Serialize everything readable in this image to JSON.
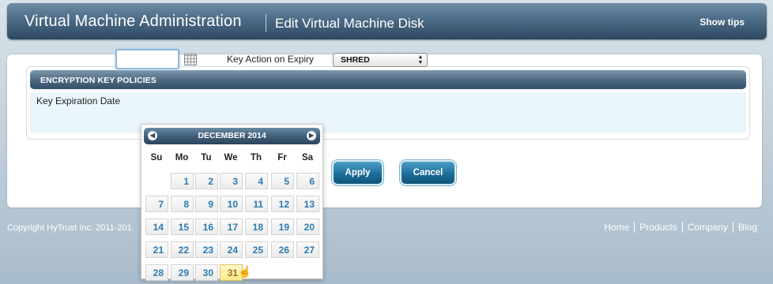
{
  "header": {
    "app_title": "Virtual Machine Administration",
    "page_title": "Edit Virtual Machine Disk",
    "show_tips": "Show tips"
  },
  "section": {
    "title": "ENCRYPTION KEY POLICIES",
    "expiration_label": "Key Expiration Date",
    "expiration_value": "",
    "action_label": "Key Action on Expiry",
    "action_value": "SHRED"
  },
  "buttons": {
    "apply": "Apply",
    "cancel": "Cancel"
  },
  "footer": {
    "copyright": "Copyright HyTrust Inc. 2011-201",
    "links": [
      "Home",
      "Products",
      "Company",
      "Blog"
    ]
  },
  "datepicker": {
    "month": "DECEMBER 2014",
    "prev_icon": "chevron-left-icon",
    "next_icon": "chevron-right-icon",
    "weekdays": [
      "Su",
      "Mo",
      "Tu",
      "We",
      "Th",
      "Fr",
      "Sa"
    ],
    "first_weekday_index": 1,
    "days": [
      "1",
      "2",
      "3",
      "4",
      "5",
      "6",
      "7",
      "8",
      "9",
      "10",
      "11",
      "12",
      "13",
      "14",
      "15",
      "16",
      "17",
      "18",
      "19",
      "20",
      "21",
      "22",
      "23",
      "24",
      "25",
      "26",
      "27",
      "28",
      "29",
      "30",
      "31"
    ],
    "highlighted_day": "31"
  },
  "colors": {
    "accent": "#2b7bb0",
    "header_dark": "#2f4a62",
    "today_bg": "#fbe98e"
  }
}
